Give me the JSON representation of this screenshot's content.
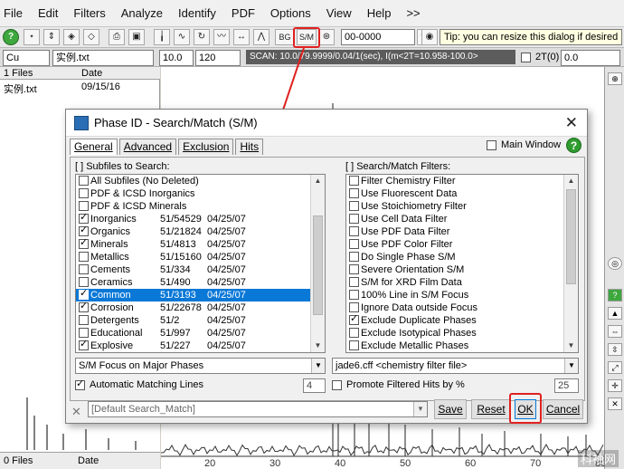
{
  "menu": [
    "File",
    "Edit",
    "Filters",
    "Analyze",
    "Identify",
    "PDF",
    "Options",
    "View",
    "Help",
    ">>"
  ],
  "toolbar": {
    "bg_label": "BG",
    "sm_label": "S/M",
    "code_value": "00-0000",
    "tip": "Tip: you can resize this dialog if desired"
  },
  "secondbar": {
    "element": "Cu",
    "filename": "实例.txt",
    "val1": "10.0",
    "val2": "120",
    "scan": "SCAN: 10.0/79.9999/0.04/1(sec), I(m<2T=10.958-100.0>",
    "twotheta_label": "2T(0)",
    "twotheta_value": "0.0"
  },
  "leftpane": {
    "header_files": "1 Files",
    "header_date": "Date",
    "file_name": "实例.txt",
    "file_date": "09/15/16",
    "footer_files": "0 Files",
    "footer_date": "Date"
  },
  "axis": [
    "20",
    "30",
    "40",
    "50",
    "60",
    "70",
    "80"
  ],
  "dialog": {
    "title": "Phase ID - Search/Match (S/M)",
    "tabs": [
      "General",
      "Advanced",
      "Exclusion",
      "Hits"
    ],
    "main_window_label": "Main Window",
    "subfiles_label": "[ ] Subfiles to Search:",
    "filters_label": "[ ] Search/Match Filters:",
    "subfiles": [
      {
        "name": "All Subfiles (No Deleted)",
        "count": "",
        "date": "",
        "checked": false,
        "selected": false
      },
      {
        "name": "PDF & ICSD Inorganics",
        "count": "",
        "date": "",
        "checked": false,
        "selected": false
      },
      {
        "name": "PDF & ICSD Minerals",
        "count": "",
        "date": "",
        "checked": false,
        "selected": false
      },
      {
        "name": "Inorganics",
        "count": "51/54529",
        "date": "04/25/07",
        "checked": true,
        "selected": false
      },
      {
        "name": "Organics",
        "count": "51/21824",
        "date": "04/25/07",
        "checked": true,
        "selected": false
      },
      {
        "name": "Minerals",
        "count": "51/4813",
        "date": "04/25/07",
        "checked": true,
        "selected": false
      },
      {
        "name": "Metallics",
        "count": "51/15160",
        "date": "04/25/07",
        "checked": false,
        "selected": false
      },
      {
        "name": "Cements",
        "count": "51/334",
        "date": "04/25/07",
        "checked": false,
        "selected": false
      },
      {
        "name": "Ceramics",
        "count": "51/490",
        "date": "04/25/07",
        "checked": false,
        "selected": false
      },
      {
        "name": "Common",
        "count": "51/3193",
        "date": "04/25/07",
        "checked": true,
        "selected": true
      },
      {
        "name": "Corrosion",
        "count": "51/22678",
        "date": "04/25/07",
        "checked": true,
        "selected": false
      },
      {
        "name": "Detergents",
        "count": "51/2",
        "date": "04/25/07",
        "checked": false,
        "selected": false
      },
      {
        "name": "Educational",
        "count": "51/997",
        "date": "04/25/07",
        "checked": false,
        "selected": false
      },
      {
        "name": "Explosive",
        "count": "51/227",
        "date": "04/25/07",
        "checked": true,
        "selected": false
      }
    ],
    "filters": [
      {
        "name": "Filter Chemistry Filter",
        "checked": false
      },
      {
        "name": "Use Fluorescent Data",
        "checked": false
      },
      {
        "name": "Use Stoichiometry Filter",
        "checked": false
      },
      {
        "name": "Use Cell Data Filter",
        "checked": false
      },
      {
        "name": "Use PDF Data Filter",
        "checked": false
      },
      {
        "name": "Use PDF Color Filter",
        "checked": false
      },
      {
        "name": "Do Single Phase S/M",
        "checked": false
      },
      {
        "name": "Severe Orientation S/M",
        "checked": false
      },
      {
        "name": "S/M for XRD Film Data",
        "checked": false
      },
      {
        "name": "100% Line in S/M Focus",
        "checked": false
      },
      {
        "name": "Ignore Data outside Focus",
        "checked": false
      },
      {
        "name": "Exclude Duplicate Phases",
        "checked": true
      },
      {
        "name": "Exclude Isotypical Phases",
        "checked": false
      },
      {
        "name": "Exclude Metallic Phases",
        "checked": false
      }
    ],
    "focus_select": "S/M Focus on Major Phases",
    "filter_file_select": "jade6.cff <chemistry filter file>",
    "auto_lines_label": "Automatic Matching Lines",
    "auto_lines_value": "4",
    "promote_label": "Promote Filtered Hits by %",
    "promote_value": "25",
    "default_search": "[Default Search_Match]",
    "save_label": "Save",
    "reset_label": "Reset",
    "ok_label": "OK",
    "cancel_label": "Cancel"
  },
  "watermark": "科袖网"
}
